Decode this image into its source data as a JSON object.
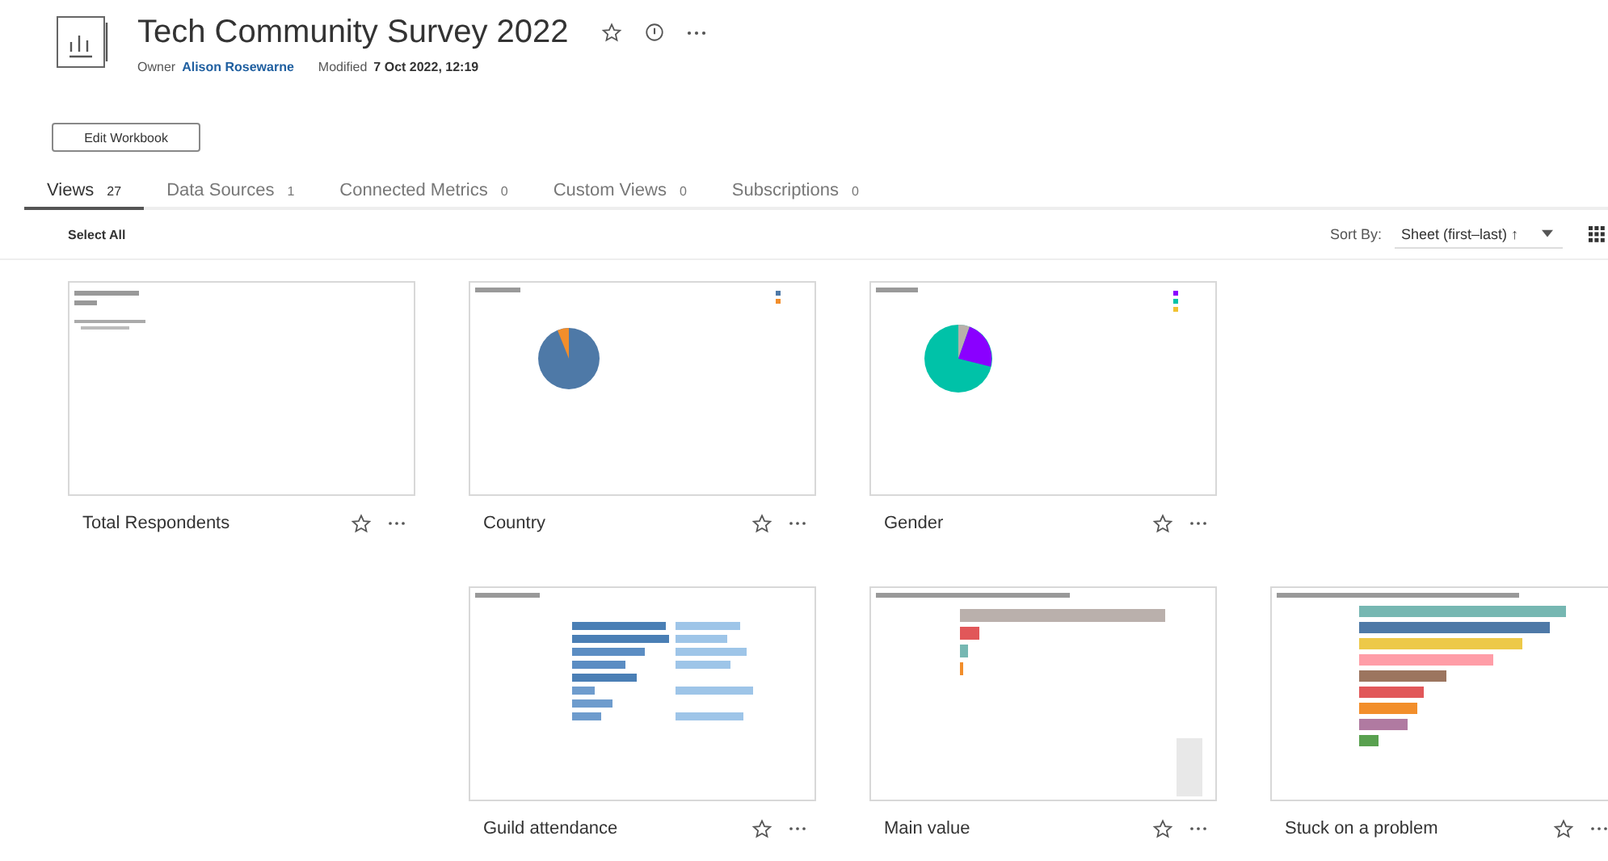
{
  "workbook": {
    "title": "Tech Community Survey 2022",
    "owner_label": "Owner",
    "owner": "Alison Rosewarne",
    "modified_label": "Modified",
    "modified": "7 Oct 2022, 12:19"
  },
  "edit_button": "Edit Workbook",
  "tabs": [
    {
      "label": "Views",
      "count": "27",
      "selected": true
    },
    {
      "label": "Data Sources",
      "count": "1",
      "selected": false
    },
    {
      "label": "Connected Metrics",
      "count": "0",
      "selected": false
    },
    {
      "label": "Custom Views",
      "count": "0",
      "selected": false
    },
    {
      "label": "Subscriptions",
      "count": "0",
      "selected": false
    }
  ],
  "toolbar": {
    "select_all": "Select All",
    "sort_label": "Sort By:",
    "sort_value": "Sheet (first–last) ↑"
  },
  "views": [
    {
      "name": "Total Respondents"
    },
    {
      "name": "Country"
    },
    {
      "name": "Gender"
    },
    {
      "name": "Guild attendance"
    },
    {
      "name": "Main value"
    },
    {
      "name": "Stuck on a problem"
    }
  ]
}
